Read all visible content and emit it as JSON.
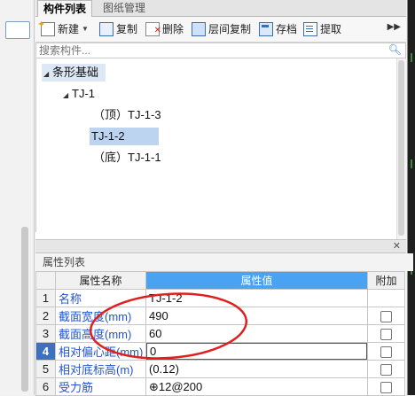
{
  "tabs": [
    {
      "label": "构件列表",
      "active": true
    },
    {
      "label": "图纸管理",
      "active": false
    }
  ],
  "toolbar": {
    "new_label": "新建",
    "copy_label": "复制",
    "delete_label": "删除",
    "layer_copy_label": "层间复制",
    "save_label": "存档",
    "extract_label": "提取",
    "more_icon": "double-chevron-right-icon"
  },
  "search": {
    "placeholder": "搜索构件...",
    "icon": "search-icon"
  },
  "tree": {
    "root": "条形基础",
    "child": "TJ-1",
    "items": [
      "（顶）TJ-1-3",
      "TJ-1-2",
      "（底）TJ-1-1"
    ],
    "selected": "TJ-1-2"
  },
  "properties": {
    "title": "属性列表",
    "headers": {
      "name": "属性名称",
      "value": "属性值",
      "extra": "附加"
    },
    "rows": [
      {
        "num": "1",
        "name": "名称",
        "value": "TJ-1-2",
        "checkbox": false
      },
      {
        "num": "2",
        "name": "截面宽度(mm)",
        "value": "490",
        "checkbox": true
      },
      {
        "num": "3",
        "name": "截面高度(mm)",
        "value": "60",
        "checkbox": true
      },
      {
        "num": "4",
        "name": "相对偏心距(mm)",
        "value": "0",
        "checkbox": true
      },
      {
        "num": "5",
        "name": "相对底标高(m)",
        "value": "(0.12)",
        "checkbox": true
      },
      {
        "num": "6",
        "name": "受力筋",
        "value": "⊕12@200",
        "checkbox": true
      }
    ]
  },
  "colors": {
    "header_accent": "#4aa3f0",
    "selection": "#bcd4f0",
    "annotation": "#e02020",
    "link_text": "#2255cc"
  }
}
